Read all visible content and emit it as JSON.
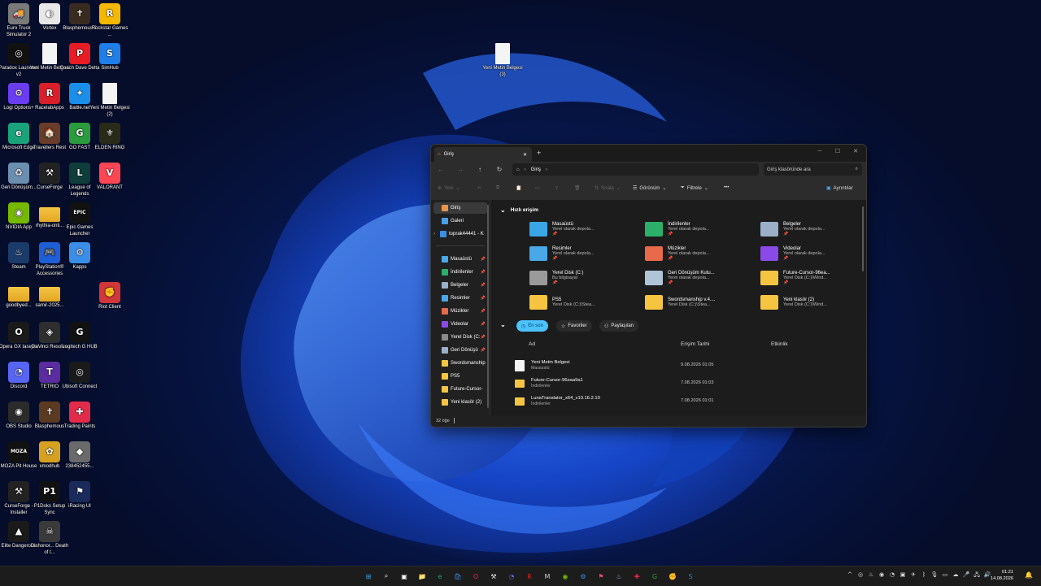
{
  "desktop": {
    "icons": [
      {
        "label": "Euro Truck Simulator 2",
        "icon": "truck-icon",
        "color": "#7a7a7a",
        "glyph": "🚚"
      },
      {
        "label": "Vortex",
        "icon": "vortex-icon",
        "color": "#e8e8e8",
        "glyph": "◐"
      },
      {
        "label": "Blasphemous 2",
        "icon": "blasphemous-icon",
        "color": "#3a2b20",
        "glyph": "✝"
      },
      {
        "label": "Rockstar Games ...",
        "icon": "rockstar-icon",
        "color": "#f5b800",
        "glyph": "R"
      },
      {
        "label": "Paradox Launcher v2",
        "icon": "paradox-icon",
        "color": "#111111",
        "glyph": "◎"
      },
      {
        "label": "Yeni Metin Belgesi",
        "icon": "text-file-icon",
        "color": "#f4f4f4",
        "glyph": ""
      },
      {
        "label": "Coach Dave Delta",
        "icon": "coach-dave-icon",
        "color": "#e81c24",
        "glyph": "P"
      },
      {
        "label": "SimHub",
        "icon": "simhub-icon",
        "color": "#1f7ee8",
        "glyph": "S"
      },
      {
        "label": "Logi Options+",
        "icon": "logi-options-icon",
        "color": "#6b3df2",
        "glyph": "⚙"
      },
      {
        "label": "RacelabApps",
        "icon": "racelab-icon",
        "color": "#d81f2a",
        "glyph": "R"
      },
      {
        "label": "Battle.net",
        "icon": "battlenet-icon",
        "color": "#1a8ee8",
        "glyph": "✦"
      },
      {
        "label": "Yeni Metin Belgesi (2)",
        "icon": "text-file-icon",
        "color": "#f4f4f4",
        "glyph": ""
      },
      {
        "label": "Microsoft Edge",
        "icon": "edge-icon",
        "color": "#1aa37a",
        "glyph": "e"
      },
      {
        "label": "Travellers Rest",
        "icon": "travellers-rest-icon",
        "color": "#6a3d2a",
        "glyph": "🏠"
      },
      {
        "label": "GO FAST",
        "icon": "go-fast-icon",
        "color": "#2b9c3d",
        "glyph": "G"
      },
      {
        "label": "ELDEN RING",
        "icon": "elden-ring-icon",
        "color": "#2a2a18",
        "glyph": "⚜"
      },
      {
        "label": "Geri Dönüşüm...",
        "icon": "recycle-bin-icon",
        "color": "#6c8fb0",
        "glyph": "♻"
      },
      {
        "label": "CurseForge",
        "icon": "curseforge-icon",
        "color": "#222222",
        "glyph": "⚒"
      },
      {
        "label": "League of Legends",
        "icon": "league-icon",
        "color": "#0f3d3a",
        "glyph": "L"
      },
      {
        "label": "VALORANT",
        "icon": "valorant-icon",
        "color": "#ff4655",
        "glyph": "V"
      },
      {
        "label": "NVIDIA App",
        "icon": "nvidia-icon",
        "color": "#76b900",
        "glyph": "◉"
      },
      {
        "label": "rhythia-onli...",
        "icon": "folder-icon",
        "color": "#f5c542",
        "glyph": ""
      },
      {
        "label": "Epic Games Launcher",
        "icon": "epic-games-icon",
        "color": "#111111",
        "glyph": "EPIC"
      },
      {
        "label": "",
        "icon": "blank-icon",
        "color": "transparent",
        "glyph": ""
      },
      {
        "label": "Steam",
        "icon": "steam-icon",
        "color": "#1b3b6a",
        "glyph": "♨"
      },
      {
        "label": "PlayStation® Accessories",
        "icon": "playstation-icon",
        "color": "#1f5fd6",
        "glyph": "🎮"
      },
      {
        "label": "Kapps",
        "icon": "kapps-icon",
        "color": "#3a8ee8",
        "glyph": "⚙"
      },
      {
        "label": "",
        "icon": "blank-icon",
        "color": "transparent",
        "glyph": ""
      },
      {
        "label": "goodbyed...",
        "icon": "folder-icon",
        "color": "#f5c542",
        "glyph": ""
      },
      {
        "label": "samir-2025...",
        "icon": "folder-icon",
        "color": "#f5c542",
        "glyph": ""
      },
      {
        "label": "",
        "icon": "blank-icon",
        "color": "transparent",
        "glyph": ""
      },
      {
        "label": "Riot Client",
        "icon": "riot-client-icon",
        "color": "#d13639",
        "glyph": "✊"
      },
      {
        "label": "Opera GX tarayıcı",
        "icon": "opera-gx-icon",
        "color": "#1a1a1a",
        "glyph": "O"
      },
      {
        "label": "DaVinci Resolve",
        "icon": "davinci-icon",
        "color": "#2e2e2e",
        "glyph": "◈"
      },
      {
        "label": "Logitech G HUB",
        "icon": "logitech-ghub-icon",
        "color": "#111111",
        "glyph": "G"
      },
      {
        "label": "",
        "icon": "blank-icon",
        "color": "transparent",
        "glyph": ""
      },
      {
        "label": "Discord",
        "icon": "discord-icon",
        "color": "#5865f2",
        "glyph": "◔"
      },
      {
        "label": "TETRIO",
        "icon": "tetrio-icon",
        "color": "#5a2ca0",
        "glyph": "T"
      },
      {
        "label": "Ubisoft Connect",
        "icon": "ubisoft-icon",
        "color": "#1a1a1a",
        "glyph": "◎"
      },
      {
        "label": "",
        "icon": "blank-icon",
        "color": "transparent",
        "glyph": ""
      },
      {
        "label": "OBS Studio",
        "icon": "obs-icon",
        "color": "#2b2b2b",
        "glyph": "◉"
      },
      {
        "label": "Blasphemous",
        "icon": "blasphemous-icon",
        "color": "#5a3a20",
        "glyph": "✝"
      },
      {
        "label": "Trading Paints",
        "icon": "trading-paints-icon",
        "color": "#e22b4a",
        "glyph": "✚"
      },
      {
        "label": "",
        "icon": "blank-icon",
        "color": "transparent",
        "glyph": ""
      },
      {
        "label": "MOZA Pit House",
        "icon": "moza-icon",
        "color": "#111111",
        "glyph": "MOZA"
      },
      {
        "label": "xmodhub",
        "icon": "xmodhub-icon",
        "color": "#d6a020",
        "glyph": "✿"
      },
      {
        "label": "238452455...",
        "icon": "image-icon",
        "color": "#6a6a6a",
        "glyph": "◆"
      },
      {
        "label": "",
        "icon": "blank-icon",
        "color": "transparent",
        "glyph": ""
      },
      {
        "label": "CurseForge - Installer",
        "icon": "curseforge-icon",
        "color": "#222222",
        "glyph": "⚒"
      },
      {
        "label": "P1Doks Setup Sync",
        "icon": "p1doks-icon",
        "color": "#111111",
        "glyph": "P1"
      },
      {
        "label": "iRacing UI",
        "icon": "iracing-icon",
        "color": "#1a2a5a",
        "glyph": "⚑"
      },
      {
        "label": "",
        "icon": "blank-icon",
        "color": "transparent",
        "glyph": ""
      },
      {
        "label": "Elite Dangerous",
        "icon": "elite-dangerous-icon",
        "color": "#1a1a1a",
        "glyph": "▲"
      },
      {
        "label": "Dishonor... Death of t...",
        "icon": "dishonored-icon",
        "color": "#3a3a3a",
        "glyph": "☠"
      }
    ],
    "floating_file": {
      "label": "Yeni Metin Belgesi (3)",
      "icon": "text-file-icon"
    }
  },
  "explorer": {
    "tab_title": "Giriş",
    "new_tab": "+",
    "address_crumb": "Giriş",
    "search_placeholder": "Giriş klasöründe ara",
    "commands": {
      "new": "Yeni",
      "sort": "Sırala",
      "view": "Görünüm",
      "filter": "Filtrele",
      "more": "•••",
      "details": "Ayrıntılar"
    },
    "nav_items": [
      {
        "label": "Giriş",
        "icon": "home-icon",
        "color": "#e8944a",
        "pinned": false,
        "selected": true
      },
      {
        "label": "Galeri",
        "icon": "gallery-icon",
        "color": "#4aa0e8",
        "pinned": false,
        "selected": false
      },
      {
        "label": "toprak44441 - K",
        "icon": "cloud-icon",
        "color": "#3a8ee8",
        "pinned": false,
        "selected": false
      },
      {
        "label": "Masaüstü",
        "icon": "desktop-icon",
        "color": "#4aa8e8",
        "pinned": true,
        "selected": false
      },
      {
        "label": "İndirilenler",
        "icon": "downloads-icon",
        "color": "#2bb06a",
        "pinned": true,
        "selected": false
      },
      {
        "label": "Belgeler",
        "icon": "documents-icon",
        "color": "#9ab0c8",
        "pinned": true,
        "selected": false
      },
      {
        "label": "Resimler",
        "icon": "pictures-icon",
        "color": "#4aa8e8",
        "pinned": true,
        "selected": false
      },
      {
        "label": "Müzikler",
        "icon": "music-icon",
        "color": "#e86a4a",
        "pinned": true,
        "selected": false
      },
      {
        "label": "Videolar",
        "icon": "videos-icon",
        "color": "#8a4ae8",
        "pinned": true,
        "selected": false
      },
      {
        "label": "Yerel Disk (C:",
        "icon": "drive-icon",
        "color": "#8a8a8a",
        "pinned": true,
        "selected": false
      },
      {
        "label": "Geri Dönüşü",
        "icon": "recycle-bin-icon",
        "color": "#9ab0c8",
        "pinned": true,
        "selected": false
      },
      {
        "label": "Swordsmanship",
        "icon": "folder-icon",
        "color": "#f5c542",
        "pinned": false,
        "selected": false
      },
      {
        "label": "PS5",
        "icon": "folder-icon",
        "color": "#f5c542",
        "pinned": false,
        "selected": false
      },
      {
        "label": "Future-Cursor-",
        "icon": "folder-icon",
        "color": "#f5c542",
        "pinned": false,
        "selected": false
      },
      {
        "label": "Yeni klasör (2)",
        "icon": "folder-icon",
        "color": "#f5c542",
        "pinned": false,
        "selected": false
      }
    ],
    "quick_access_title": "Hızlı erişim",
    "quick_access": [
      {
        "name": "Masaüstü",
        "loc": "Yerel olarak depola...",
        "pin": "📌",
        "icon": "desktop-folder-icon",
        "color": "#3aa6e8"
      },
      {
        "name": "İndirilenler",
        "loc": "Yerel olarak depola...",
        "pin": "📌",
        "icon": "downloads-folder-icon",
        "color": "#2bb06a"
      },
      {
        "name": "Belgeler",
        "loc": "Yerel olarak depola...",
        "pin": "📌",
        "icon": "documents-folder-icon",
        "color": "#9ab0c8"
      },
      {
        "name": "Resimler",
        "loc": "Yerel olarak depola...",
        "pin": "📌",
        "icon": "pictures-folder-icon",
        "color": "#4aa8e8"
      },
      {
        "name": "Müzikler",
        "loc": "Yerel olarak depola...",
        "pin": "📌",
        "icon": "music-folder-icon",
        "color": "#e86a4a"
      },
      {
        "name": "Videolar",
        "loc": "Yerel olarak depola...",
        "pin": "📌",
        "icon": "videos-folder-icon",
        "color": "#8a4ae8"
      },
      {
        "name": "Yerel Disk (C:)",
        "loc": "Bu bilgisayar",
        "pin": "📌",
        "icon": "drive-icon",
        "color": "#9a9a9a"
      },
      {
        "name": "Geri Dönüşüm Kutu...",
        "loc": "Yerel olarak depola...",
        "pin": "📌",
        "icon": "recycle-bin-icon",
        "color": "#b0c4d8"
      },
      {
        "name": "Future-Cursor-96ea...",
        "loc": "Yerel Disk (C:)\\Wind...",
        "pin": "📌",
        "icon": "folder-icon",
        "color": "#f5c542"
      },
      {
        "name": "PS5",
        "loc": "Yerel Disk (C:)\\Stea...",
        "pin": "",
        "icon": "folder-icon",
        "color": "#f5c542"
      },
      {
        "name": "Swordsmanship v.4....",
        "loc": "Yerel Disk (C:)\\Stea...",
        "pin": "",
        "icon": "folder-icon",
        "color": "#f5c542"
      },
      {
        "name": "Yeni klasör (2)",
        "loc": "Yerel Disk (C:)\\Wind...",
        "pin": "",
        "icon": "folder-icon",
        "color": "#f5c542"
      }
    ],
    "filter_pills": [
      {
        "label": "En son",
        "icon": "clock-icon",
        "active": true
      },
      {
        "label": "Favoriler",
        "icon": "star-icon",
        "active": false
      },
      {
        "label": "Paylaşılan",
        "icon": "people-icon",
        "active": false
      }
    ],
    "columns": {
      "name": "Ad",
      "date": "Erişim Tarihi",
      "activity": "Etkinlik"
    },
    "recent_files": [
      {
        "name": "Yeni Metin Belgesi",
        "loc": "Masaüstü",
        "date": "9.08.2026 01:05",
        "icon": "text-file-icon",
        "color": "#f4f4f4"
      },
      {
        "name": "Future-Cursor-96eaa9a1",
        "loc": "İndirilenler",
        "date": "7.08.2026 01:03",
        "icon": "folder-icon",
        "color": "#f5c542"
      },
      {
        "name": "LunaTranslator_x64_v10.16.2.10",
        "loc": "İndirilenler",
        "date": "7.08.2026 01:01",
        "icon": "folder-icon",
        "color": "#f5c542"
      }
    ],
    "status": "32 öğe"
  },
  "taskbar": {
    "apps": [
      {
        "icon": "start-icon",
        "glyph": "⊞",
        "color": "#3aa6e8"
      },
      {
        "icon": "search-icon",
        "glyph": "⌕",
        "color": "#ffffff"
      },
      {
        "icon": "task-view-icon",
        "glyph": "▣",
        "color": "#ffffff"
      },
      {
        "icon": "file-explorer-icon",
        "glyph": "📁",
        "color": "#f5c542"
      },
      {
        "icon": "edge-icon",
        "glyph": "e",
        "color": "#1aa37a"
      },
      {
        "icon": "store-icon",
        "glyph": "🛍",
        "color": "#3a8ee8"
      },
      {
        "icon": "opera-gx-icon",
        "glyph": "O",
        "color": "#e8284a"
      },
      {
        "icon": "curseforge-icon",
        "glyph": "⚒",
        "color": "#e8e8e8"
      },
      {
        "icon": "discord-icon",
        "glyph": "◔",
        "color": "#5865f2"
      },
      {
        "icon": "racelab-icon",
        "glyph": "R",
        "color": "#d81f2a"
      },
      {
        "icon": "moza-icon",
        "glyph": "M",
        "color": "#cccccc"
      },
      {
        "icon": "nvidia-icon",
        "glyph": "◉",
        "color": "#76b900"
      },
      {
        "icon": "kapps-icon",
        "glyph": "⚙",
        "color": "#3a8ee8"
      },
      {
        "icon": "iracing-icon",
        "glyph": "⚑",
        "color": "#e84a6a"
      },
      {
        "icon": "steam-icon",
        "glyph": "♨",
        "color": "#9ab0c8"
      },
      {
        "icon": "trading-paints-icon",
        "glyph": "✚",
        "color": "#e22b4a"
      },
      {
        "icon": "go-fast-icon",
        "glyph": "G",
        "color": "#2b9c3d"
      },
      {
        "icon": "riot-client-icon",
        "glyph": "✊",
        "color": "#d13639"
      },
      {
        "icon": "simhub-icon",
        "glyph": "S",
        "color": "#1f7ee8"
      }
    ],
    "tray": [
      {
        "icon": "chevron-up-icon",
        "glyph": "^"
      },
      {
        "icon": "ubisoft-tray-icon",
        "glyph": "◎"
      },
      {
        "icon": "steam-tray-icon",
        "glyph": "♨"
      },
      {
        "icon": "nvidia-tray-icon",
        "glyph": "◉"
      },
      {
        "icon": "discord-tray-icon",
        "glyph": "◔"
      },
      {
        "icon": "app-tray-icon",
        "glyph": "▣"
      },
      {
        "icon": "moza-tray-icon",
        "glyph": "✈"
      },
      {
        "icon": "bluetooth-icon",
        "glyph": "ᛒ"
      },
      {
        "icon": "mic-muted-icon",
        "glyph": "🎙"
      },
      {
        "icon": "display-icon",
        "glyph": "▭"
      },
      {
        "icon": "weather-icon",
        "glyph": "☁"
      },
      {
        "icon": "microphone-icon",
        "glyph": "🎤"
      },
      {
        "icon": "network-icon",
        "glyph": "🖧"
      },
      {
        "icon": "volume-icon",
        "glyph": "🔊"
      }
    ],
    "time": "01:21",
    "date": "14.08.2026",
    "bell": "🔔"
  }
}
